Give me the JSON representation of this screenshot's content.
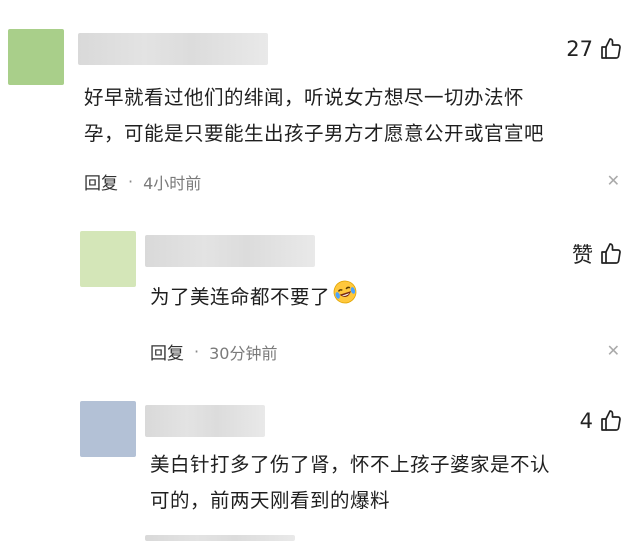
{
  "comments": [
    {
      "likes": "27",
      "text_lines": [
        "好早就看过他们的绯闻，听说女方想尽一切办法怀",
        "孕，可能是只要能生出孩子男方才愿意公开或官宣吧"
      ],
      "reply_label": "回复",
      "time": "4小时前",
      "avatar_color": "#a9cf8a"
    },
    {
      "likes": "赞",
      "text_lines": [
        "为了美连命都不要了"
      ],
      "emoji": "crying-laughing-emoji",
      "reply_label": "回复",
      "time": "30分钟前",
      "avatar_color": "#d4e6b8"
    },
    {
      "likes": "4",
      "text_lines": [
        "美白针打多了伤了肾，怀不上孩子婆家是不认",
        "可的，前两天刚看到的爆料"
      ],
      "avatar_color": "#b3c1d6"
    }
  ],
  "separator": "·"
}
